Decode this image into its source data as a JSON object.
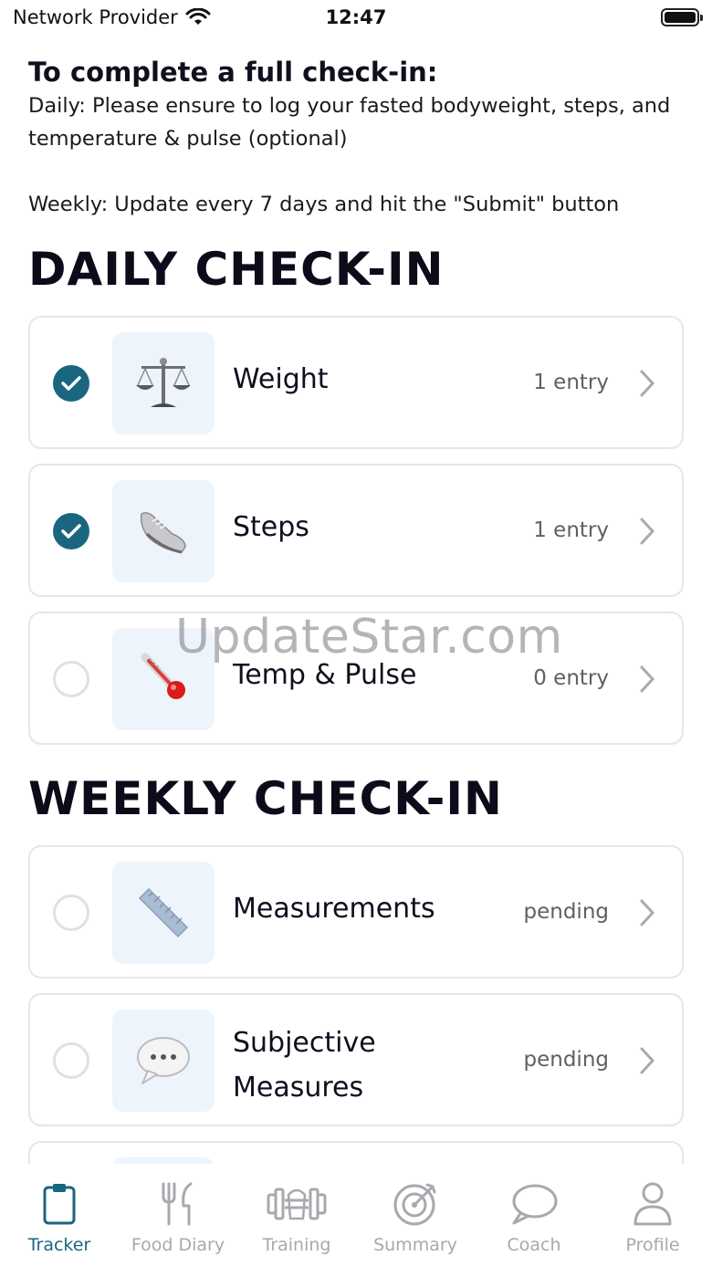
{
  "status_bar": {
    "carrier": "Network Provider",
    "time": "12:47"
  },
  "intro": {
    "title": "To complete a full check-in:",
    "daily_text": "Daily: Please ensure to log your fasted bodyweight, steps, and temperature & pulse (optional)",
    "weekly_text": "Weekly: Update every 7 days and hit the \"Submit\" button"
  },
  "daily": {
    "heading": "DAILY CHECK-IN",
    "items": [
      {
        "label": "Weight",
        "meta": "1 entry",
        "completed": true,
        "icon": "scale-icon"
      },
      {
        "label": "Steps",
        "meta": "1 entry",
        "completed": true,
        "icon": "sneaker-icon"
      },
      {
        "label": "Temp & Pulse",
        "meta": "0 entry",
        "completed": false,
        "icon": "thermometer-icon"
      }
    ]
  },
  "weekly": {
    "heading": "WEEKLY CHECK-IN",
    "items": [
      {
        "label": "Measurements",
        "meta": "pending",
        "completed": false,
        "icon": "ruler-icon"
      },
      {
        "label": "Subjective Measures",
        "label_line1": "Subjective",
        "label_line2": "Measures",
        "meta": "pending",
        "completed": false,
        "icon": "speech-bubble-icon"
      }
    ]
  },
  "watermark": "UpdateStar.com",
  "tabs": [
    {
      "label": "Tracker",
      "icon": "clipboard-icon",
      "active": true
    },
    {
      "label": "Food Diary",
      "icon": "fork-knife-icon",
      "active": false
    },
    {
      "label": "Training",
      "icon": "dumbbell-icon",
      "active": false
    },
    {
      "label": "Summary",
      "icon": "target-icon",
      "active": false
    },
    {
      "label": "Coach",
      "icon": "chat-icon",
      "active": false
    },
    {
      "label": "Profile",
      "icon": "person-icon",
      "active": false
    }
  ],
  "colors": {
    "accent": "#1a6680",
    "icon_bg": "#edf4fc",
    "tab_inactive": "#a8a8ae"
  }
}
